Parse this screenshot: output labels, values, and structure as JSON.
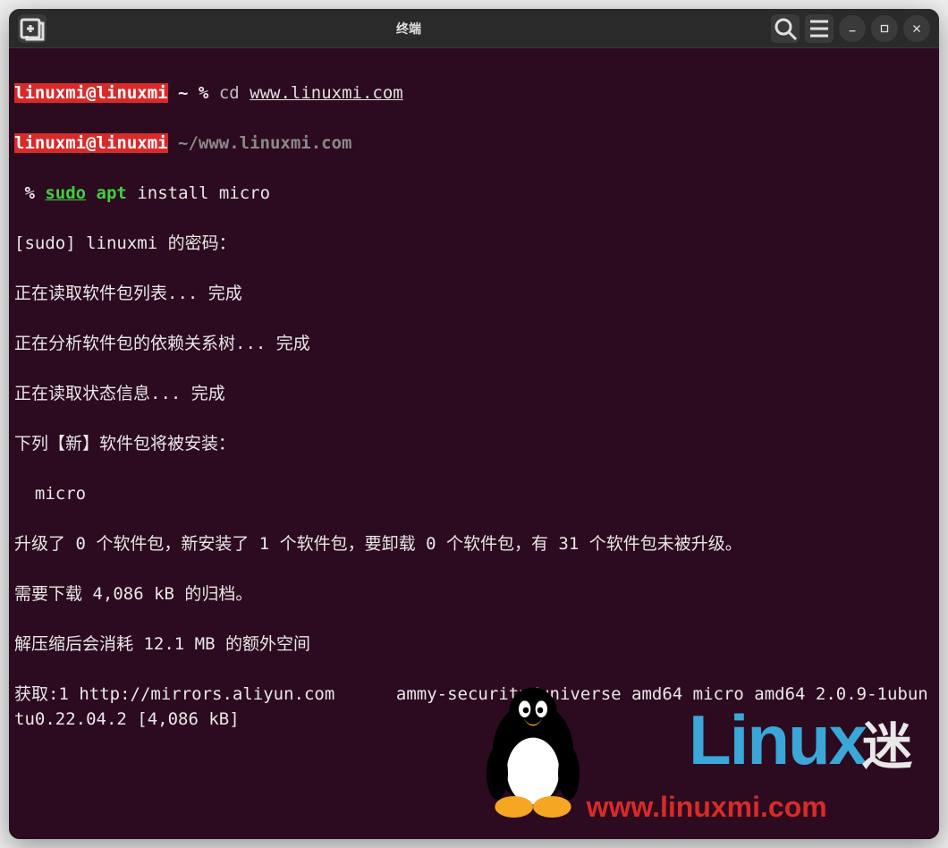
{
  "window": {
    "title": "终端"
  },
  "prompt1": {
    "userhost": "linuxmi@linuxmi",
    "tilde": " ~ ",
    "percent": "% ",
    "cmd": "cd ",
    "url": "www.linuxmi.com"
  },
  "prompt2": {
    "userhost": "linuxmi@linuxmi",
    "path": " ~/www.linuxmi.com"
  },
  "prompt3": {
    "percent": " % ",
    "sudo": "sudo",
    "apt": " apt",
    "rest": " install micro"
  },
  "output": {
    "l1": "[sudo] linuxmi 的密码：",
    "l2": "正在读取软件包列表... 完成",
    "l3": "正在分析软件包的依赖关系树... 完成",
    "l4": "正在读取状态信息... 完成",
    "l5": "下列【新】软件包将被安装：",
    "l6": "  micro",
    "l7": "升级了 0 个软件包，新安装了 1 个软件包，要卸载 0 个软件包，有 31 个软件包未被升级。",
    "l8": "需要下载 4,086 kB 的归档。",
    "l9": "解压缩后会消耗 12.1 MB 的额外空间",
    "l10": "获取:1 http://mirrors.aliyun.com      ammy-security/universe amd64 micro amd64 2.0.9-1ubuntu0.22.04.2 [4,086 kB]"
  },
  "watermark": {
    "text1": "Linux",
    "text2": "迷",
    "url": "www.linuxmi.com"
  }
}
